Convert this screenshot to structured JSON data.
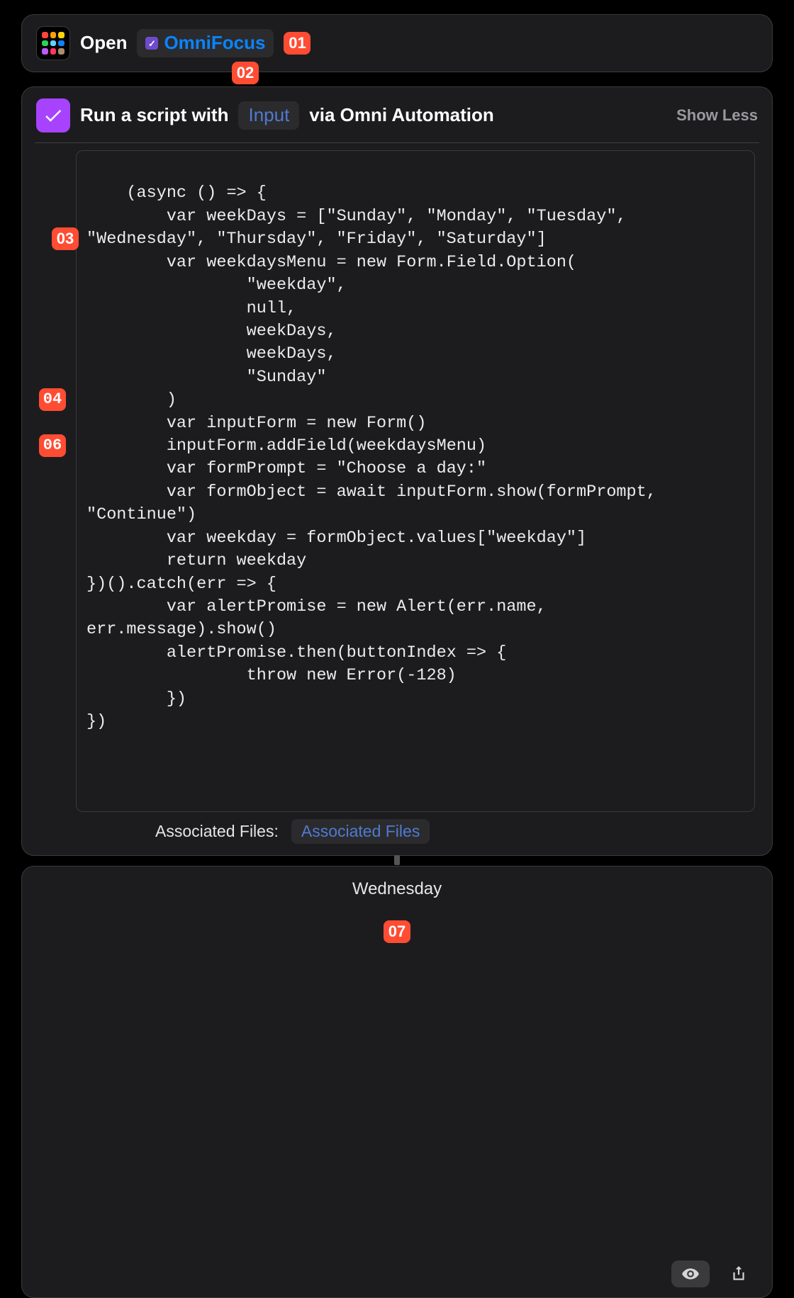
{
  "action_open": {
    "verb": "Open",
    "app_name": "OmniFocus",
    "badge": "01"
  },
  "action_script": {
    "title_prefix": "Run a script with",
    "input_token": "Input",
    "title_suffix": "via Omni Automation",
    "show_less": "Show Less",
    "badge_top": "02",
    "badge_code_start": "03",
    "badge_line_a": "04",
    "badge_line_b": "06",
    "code": "(async () => {\n        var weekDays = [\"Sunday\", \"Monday\", \"Tuesday\", \"Wednesday\", \"Thursday\", \"Friday\", \"Saturday\"]\n        var weekdaysMenu = new Form.Field.Option(\n                \"weekday\",\n                null,\n                weekDays,\n                weekDays,\n                \"Sunday\"\n        )\n        var inputForm = new Form()\n        inputForm.addField(weekdaysMenu)\n        var formPrompt = \"Choose a day:\"\n        var formObject = await inputForm.show(formPrompt, \"Continue\")\n        var weekday = formObject.values[\"weekday\"]\n        return weekday\n})().catch(err => {\n        var alertPromise = new Alert(err.name, err.message).show()\n        alertPromise.then(buttonIndex => {\n                throw new Error(-128)\n        })\n})",
    "associated_label": "Associated Files:",
    "associated_value": "Associated Files"
  },
  "result": {
    "text": "Wednesday",
    "badge": "07"
  }
}
